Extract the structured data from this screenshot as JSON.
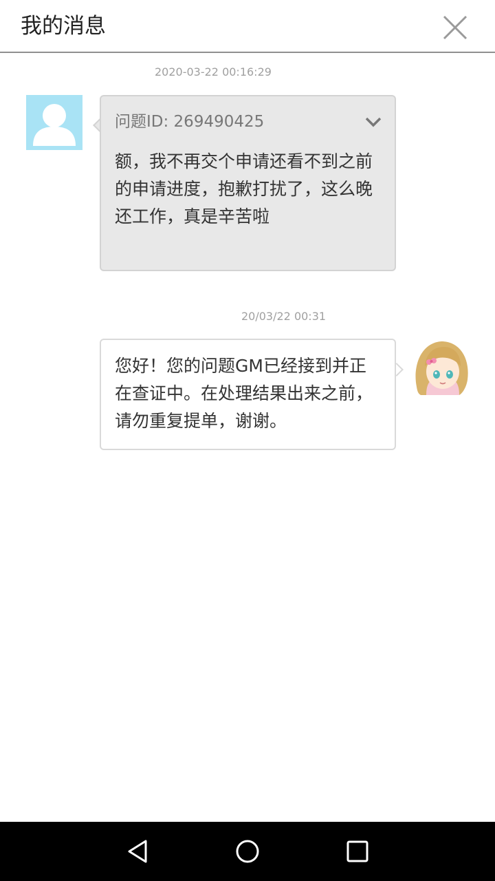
{
  "header": {
    "title": "我的消息",
    "close_icon": "close-icon"
  },
  "messages": [
    {
      "sender": "user",
      "timestamp": "2020-03-22 00:16:29",
      "question_id": "问题ID: 269490425",
      "text": "额，我不再交个申请还看不到之前的申请进度，抱歉打扰了，这么晚还工作，真是辛苦啦",
      "avatar_icon": "user-avatar-icon",
      "expand_icon": "chevron-down-icon"
    },
    {
      "sender": "gm",
      "timestamp": "20/03/22 00:31",
      "text": "您好！您的问题GM已经接到并正在查证中。在处理结果出来之前，请勿重复提单，谢谢。",
      "avatar_icon": "gm-avatar-icon"
    }
  ],
  "navbar": {
    "back_icon": "back-triangle-icon",
    "home_icon": "home-circle-icon",
    "recent_icon": "recent-square-icon"
  },
  "colors": {
    "user_bubble": "#e8e8e8",
    "gm_bubble": "#ffffff",
    "avatar_bg": "#a9e3f5",
    "timestamp": "#a0a0a0",
    "navbar": "#000000"
  }
}
